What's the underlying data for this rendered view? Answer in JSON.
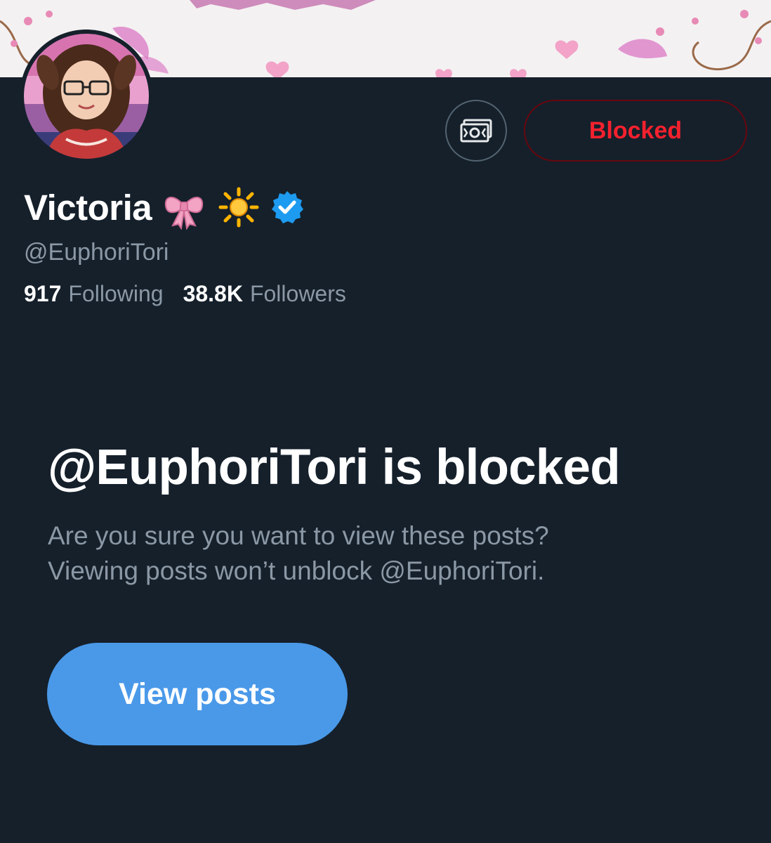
{
  "profile": {
    "display_name": "Victoria",
    "name_emojis": [
      "ribbon-emoji",
      "sun-emoji"
    ],
    "verified": true,
    "handle": "@EuphoriTori",
    "following_count": "917",
    "following_label": "Following",
    "followers_count": "38.8K",
    "followers_label": "Followers"
  },
  "actions": {
    "tip_icon": "money-icon",
    "blocked_label": "Blocked"
  },
  "notice": {
    "title": "@EuphoriTori is blocked",
    "line1": "Are you sure you want to view these posts?",
    "line2": "Viewing posts won’t unblock @EuphoriTori.",
    "button_label": "View posts"
  },
  "colors": {
    "background": "#15202b",
    "secondary_text": "#8b98a5",
    "blocked_red": "#f4212e",
    "primary_button": "#4a99e9",
    "verified_blue": "#1d9bf0"
  }
}
